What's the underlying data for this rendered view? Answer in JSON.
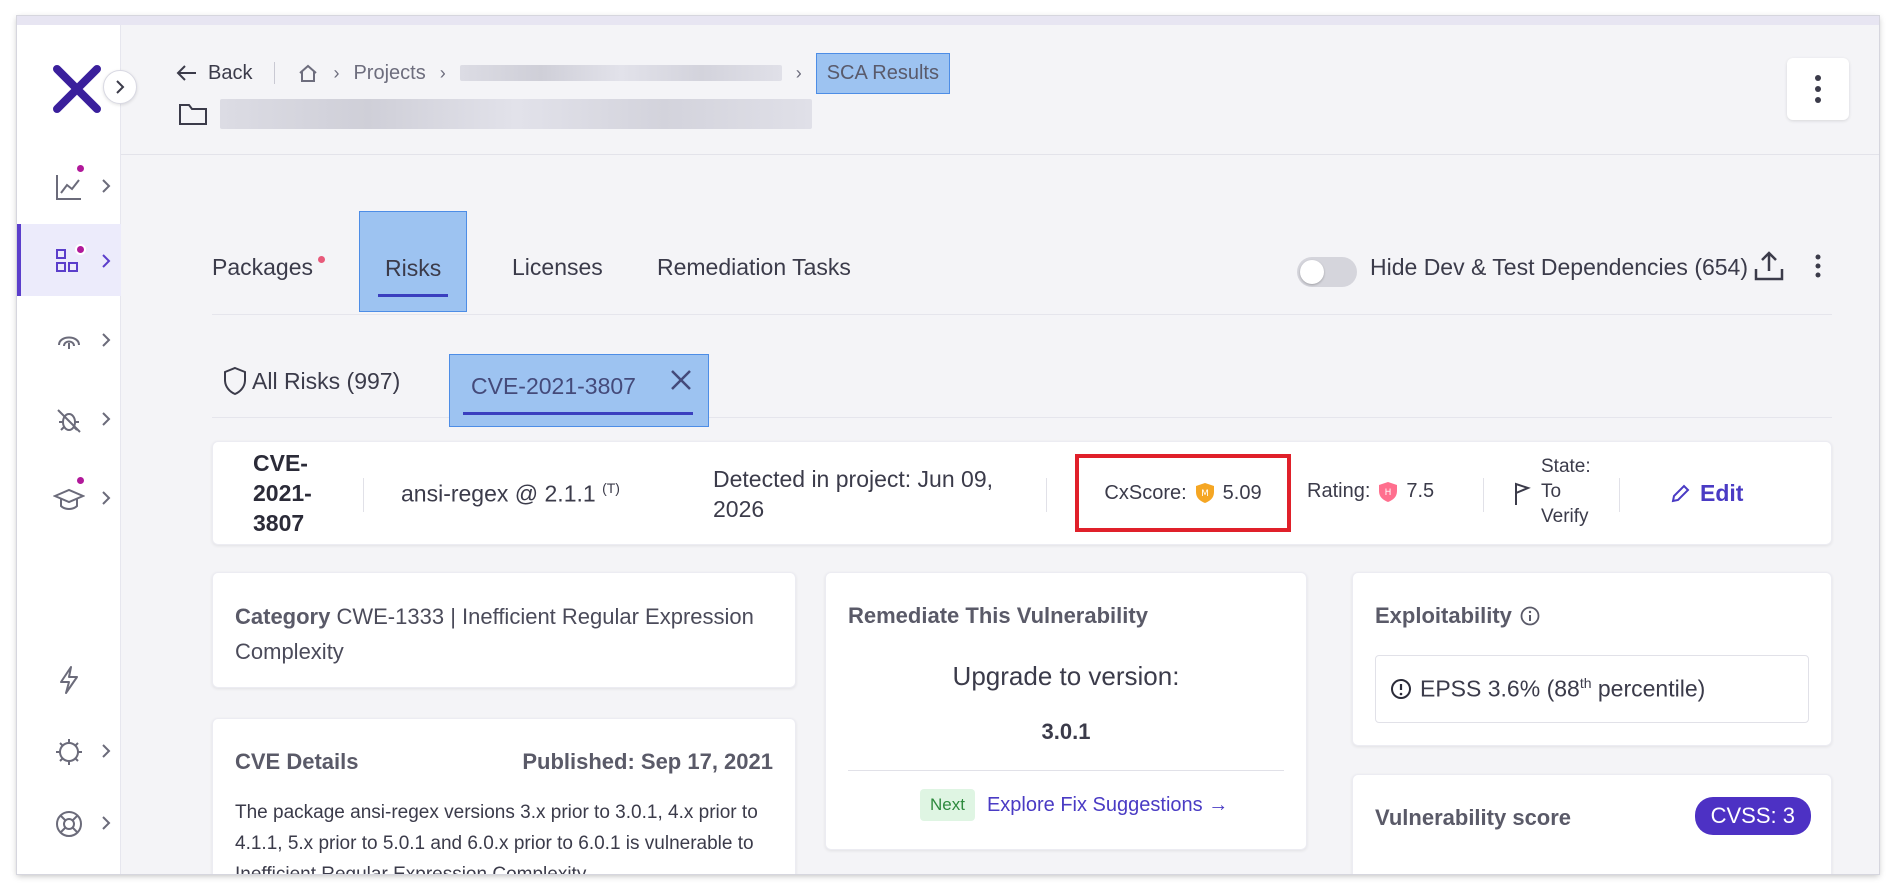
{
  "header": {
    "back_label": "Back",
    "crumb_projects": "Projects",
    "crumb_current": "SCA Results"
  },
  "tabs": {
    "packages": "Packages",
    "risks": "Risks",
    "licenses": "Licenses",
    "remediation": "Remediation Tasks",
    "toggle_label": "Hide Dev & Test Dependencies (654)",
    "toggle_on": false
  },
  "subtabs": {
    "all_risks": "All Risks (997)",
    "cve_tab": "CVE-2021-3807"
  },
  "summary": {
    "cve_id": "CVE-2021-3807",
    "package": "ansi-regex @ 2.1.1",
    "package_tag": "(T)",
    "detected": "Detected in project: Jun 09, 2026",
    "cxscore_label": "CxScore:",
    "cxscore_value": "5.09",
    "cxscore_badge": "M",
    "rating_label": "Rating:",
    "rating_value": "7.5",
    "rating_badge": "H",
    "state": "State: To Verify",
    "edit_label": "Edit"
  },
  "category": {
    "label": "Category",
    "value": "CWE-1333 | Inefficient Regular Expression Complexity"
  },
  "cve_details": {
    "title": "CVE Details",
    "published": "Published: Sep 17, 2021",
    "description": "The package ansi-regex versions 3.x prior to 3.0.1, 4.x prior to 4.1.1, 5.x prior to 5.0.1 and 6.0.x prior to 6.0.1 is vulnerable to Inefficient Regular Expression Complexity"
  },
  "remediate": {
    "title": "Remediate This Vulnerability",
    "upgrade_label": "Upgrade to version:",
    "version": "3.0.1",
    "next_badge": "Next",
    "explore_link": "Explore Fix Suggestions →"
  },
  "exploitability": {
    "title": "Exploitability",
    "epss_text": "EPSS 3.6% (88",
    "epss_sup": "th",
    "epss_suffix": " percentile)"
  },
  "vulnerability_score": {
    "title": "Vulnerability score",
    "cvss_badge": "CVSS: 3",
    "bar_fill_fraction": 0.41
  },
  "colors": {
    "accent": "#4a3bc4",
    "highlight": "#9dc3f1",
    "highlight_border": "#4d8de6",
    "red_box": "#e0202a",
    "high_severity": "#ff6f8e",
    "medium_severity": "#f5a623",
    "nav_dot": "#b1189a"
  },
  "sidebar": {
    "icons": [
      "dashboard-chart-icon",
      "applications-grid-icon",
      "fingerprint-icon",
      "bug-icon",
      "graduation-cap-icon",
      "lightning-icon",
      "settings-gear-icon",
      "help-lifebuoy-icon"
    ]
  }
}
